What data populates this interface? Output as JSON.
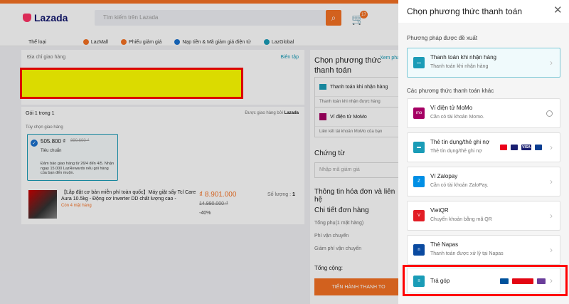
{
  "header": {
    "logo": "Lazada",
    "search_placeholder": "Tìm kiếm trên Lazada",
    "cart_count": "17",
    "nav": [
      "Thể loại",
      "LazMall",
      "Phiếu giảm giá",
      "Nạp tiền & Mã giảm giá điện tử",
      "LazGlobal"
    ]
  },
  "address": {
    "title": "Địa chỉ giao hàng",
    "edit": "Biên tập"
  },
  "package": {
    "title": "Gói 1 trong 1",
    "shipped_by_label": "Được giao hàng bởi",
    "shipped_by": "Lazada",
    "option_label": "Tùy chọn giao hàng",
    "option_price": "505.800 ₫",
    "option_old_price": "890.600 ₫",
    "option_tier": "Tiêu chuẩn",
    "option_note": "Đảm bảo giao hàng từ 26/4 đến 4/5. Nhận ngay 15.000 LazRewards nếu gói hàng của bạn đến muộn."
  },
  "product": {
    "name": "【Lắp đặt cơ bản miễn phí toàn quốc】Máy giặt sấy Tcl Care Aura 10.5kg - Động cơ Inverter DD chất lượng cao -",
    "stock": "Còn 4 mặt hàng",
    "price": "₫ 8.901.000",
    "old_price": "14.990.000 ₫",
    "discount": "-40%",
    "qty_label": "Số lượng :",
    "qty": "1"
  },
  "summary": {
    "title": "Chọn phương thức thanh toán",
    "view": "Xem pháp",
    "method_cod": "Thanh toán khi nhận hàng",
    "method_cod_sub": "Thanh toán khi nhận được hàng",
    "method_momo": "Ví điện tử MoMo",
    "method_momo_sub": "Liên kết tài khoản MoMo của bạn",
    "voucher_title": "Chứng từ",
    "voucher_placeholder": "Nhập mã giảm giá",
    "invoice_title": "Thông tin hóa đơn và liên hệ",
    "detail_title": "Chi tiết đơn hàng",
    "subtotal": "Tổng phụ(1 mặt hàng)",
    "shipping": "Phí vận chuyển",
    "ship_discount": "Giảm phí vận chuyển",
    "total": "Tổng cộng:",
    "button": "TIẾN HÀNH THANH TO"
  },
  "modal": {
    "title": "Chọn phương thức thanh toán",
    "suggested_label": "Phương pháp được đề xuất",
    "other_label": "Các phương thức thanh toán khác",
    "methods": [
      {
        "name": "Thanh toán khi nhận hàng",
        "desc": "Thanh toán khi nhận hàng",
        "icon": "cash-icon"
      },
      {
        "name": "Ví điện tử MoMo",
        "desc": "Cần có tài khoản Momo.",
        "icon": "momo-icon"
      },
      {
        "name": "Thẻ tín dụng/thẻ ghi nợ",
        "desc": "Thẻ tín dụng/thẻ ghi nợ",
        "icon": "card-icon"
      },
      {
        "name": "Ví Zalopay",
        "desc": "Cần có tài khoản ZaloPay.",
        "icon": "zalopay-icon"
      },
      {
        "name": "VietQR",
        "desc": "Chuyển khoản bằng mã QR",
        "icon": "vietqr-icon"
      },
      {
        "name": "Thẻ Napas",
        "desc": "Thanh toán được xử lý tại Napas",
        "icon": "napas-icon"
      },
      {
        "name": "Trả góp",
        "desc": "",
        "icon": "installment-icon"
      }
    ]
  },
  "colors": {
    "accent": "#f57224",
    "highlight": "#ff0000",
    "redaction": "#ffff00",
    "link": "#1a9cb7"
  }
}
